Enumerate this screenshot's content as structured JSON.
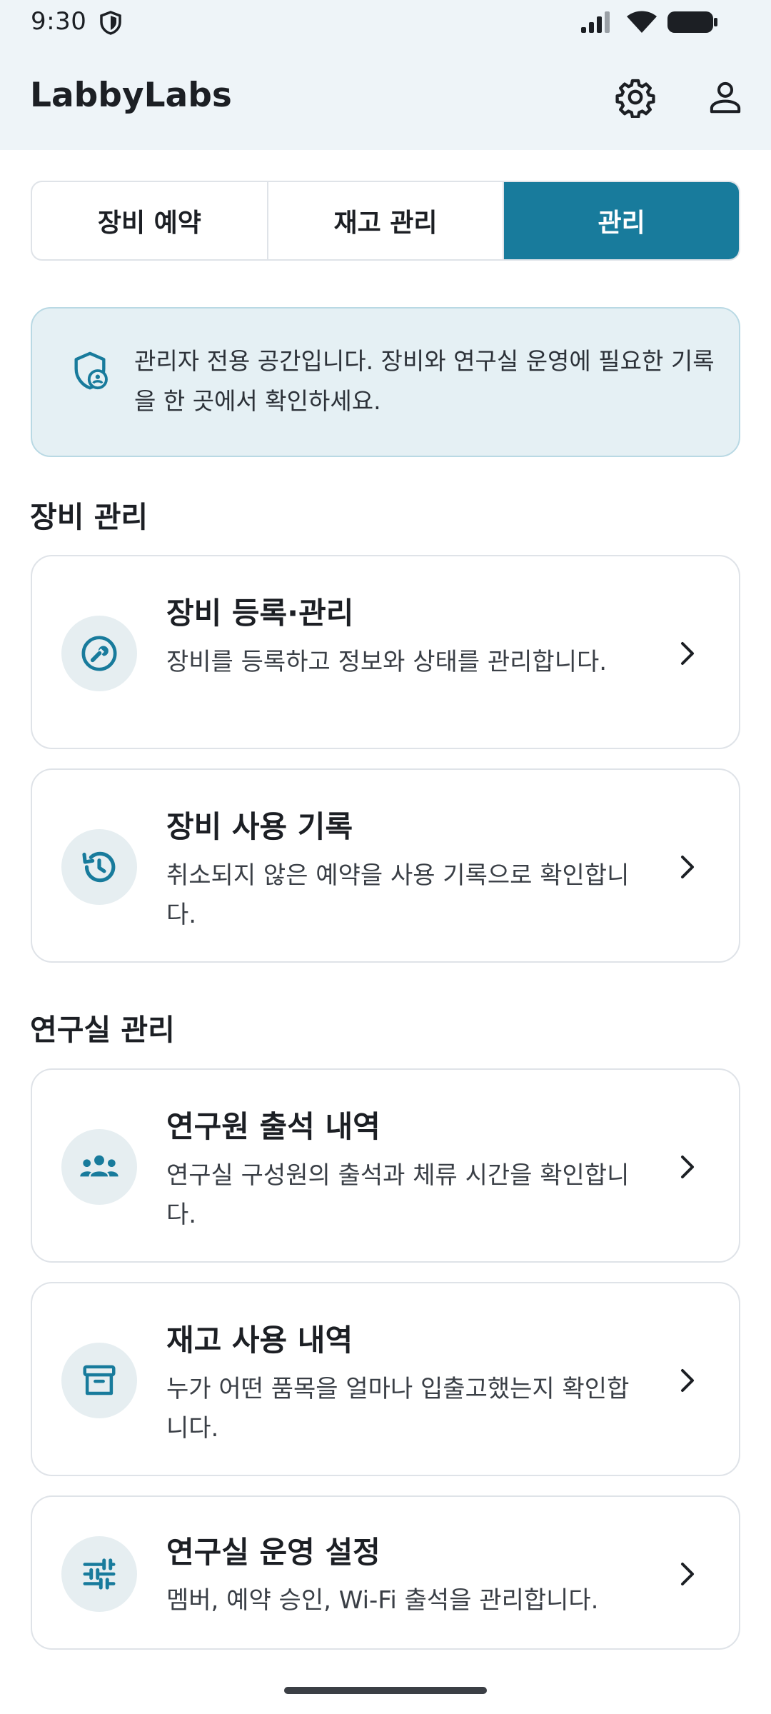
{
  "status_bar": {
    "time": "9:30"
  },
  "app": {
    "title": "LabbyLabs"
  },
  "tabs": [
    {
      "label": "장비 예약",
      "active": false
    },
    {
      "label": "재고 관리",
      "active": false
    },
    {
      "label": "관리",
      "active": true
    }
  ],
  "notice": {
    "text": "관리자 전용 공간입니다. 장비와 연구실 운영에 필요한 기록을 한 곳에서 확인하세요."
  },
  "sections": [
    {
      "title": "장비 관리",
      "items": [
        {
          "title": "장비 등록·관리",
          "description": "장비를 등록하고 정보와 상태를 관리합니다.",
          "icon": "wrench-icon"
        },
        {
          "title": "장비 사용 기록",
          "description": "취소되지 않은 예약을 사용 기록으로 확인합니다.",
          "icon": "history-icon"
        }
      ]
    },
    {
      "title": "연구실 관리",
      "items": [
        {
          "title": "연구원 출석 내역",
          "description": "연구실 구성원의 출석과 체류 시간을 확인합니다.",
          "icon": "group-icon"
        },
        {
          "title": "재고 사용 내역",
          "description": "누가 어떤 품목을 얼마나 입출고했는지 확인합니다.",
          "icon": "archive-icon"
        },
        {
          "title": "연구실 운영 설정",
          "description": "멤버, 예약 승인, Wi-Fi 출석을 관리합니다.",
          "icon": "sliders-icon"
        }
      ]
    }
  ],
  "colors": {
    "accent": "#187b9c",
    "header_bg": "#eef4f8",
    "notice_bg": "#e5f0f4",
    "icon_circle_bg": "#e6eef1"
  }
}
